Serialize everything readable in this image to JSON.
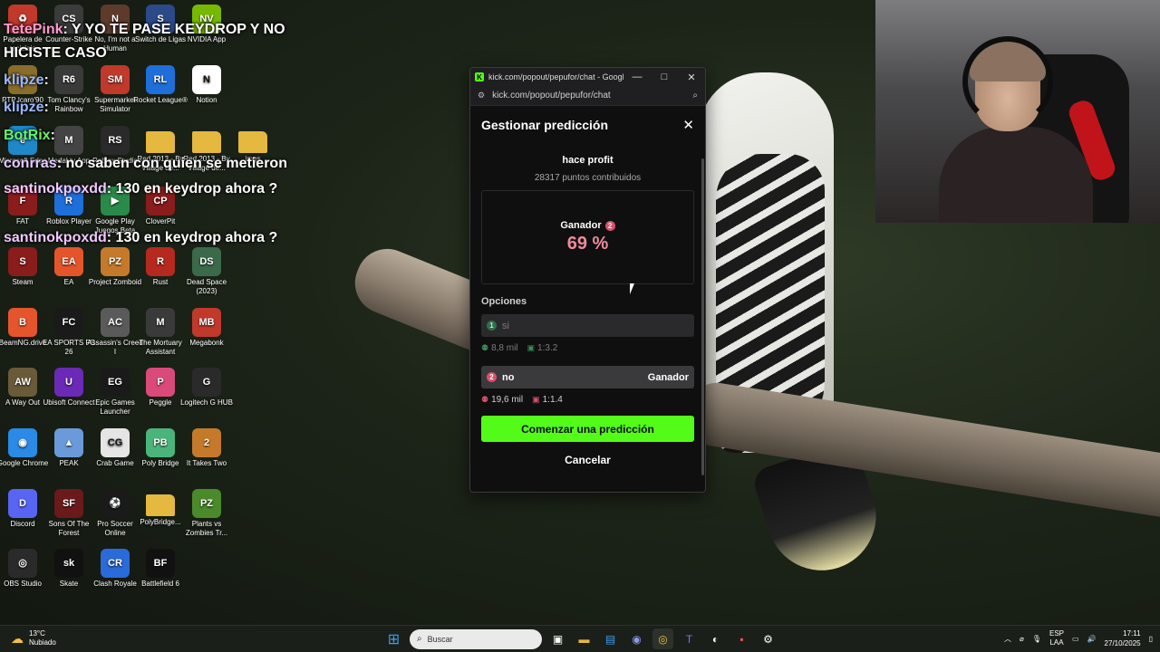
{
  "overlay_chat": [
    {
      "user": "TetePink",
      "message": ": Y YO TE PASE KEYDROP Y NO"
    },
    {
      "user": "",
      "message": "HICISTE CASO"
    },
    {
      "user": "klipze",
      "message": ":"
    },
    {
      "user": "klipze",
      "message": ":"
    },
    {
      "user": "BotRix",
      "message": ":"
    },
    {
      "user": "conrras",
      "message": ": no saben con quien se metieron"
    },
    {
      "user": "santinokpoxdd",
      "message": ": 130 en keydrop ahora ?"
    },
    {
      "user": "santinokpoxdd",
      "message": ": 130 en keydrop ahora ?"
    }
  ],
  "desktop_icons": [
    {
      "label": "Papelera de reciclaje",
      "icon": "recycle-bin-icon",
      "color": "#c0392b",
      "glyph": "♻"
    },
    {
      "label": "Counter-Strike",
      "icon": "counter-strike-icon",
      "color": "#3b3b3b",
      "glyph": "CS"
    },
    {
      "label": "No, I'm not a Human",
      "icon": "no-human-icon",
      "color": "#5e3a2a",
      "glyph": "N"
    },
    {
      "label": "Switch de Ligas",
      "icon": "switch-ligas-icon",
      "color": "#2b4a8a",
      "glyph": "S"
    },
    {
      "label": "NVIDIA App",
      "icon": "nvidia-icon",
      "color": "#76b900",
      "glyph": "NV"
    },
    {
      "label": "PTP Icaro'90",
      "icon": "ptp-icon",
      "color": "#8a6d2a",
      "glyph": "P"
    },
    {
      "label": "Tom Clancy's Rainbow",
      "icon": "rainbow-six-icon",
      "color": "#3a3a3a",
      "glyph": "R6"
    },
    {
      "label": "Supermarket Simulator",
      "icon": "supermarket-icon",
      "color": "#c0392b",
      "glyph": "SM"
    },
    {
      "label": "Rocket League®",
      "icon": "rocket-league-icon",
      "color": "#1e6fd9",
      "glyph": "RL"
    },
    {
      "label": "Notion",
      "icon": "notion-icon",
      "color": "#ffffff",
      "glyph": "N"
    },
    {
      "label": "Microsoft Edge",
      "icon": "edge-icon",
      "color": "#1e88c8",
      "glyph": "e"
    },
    {
      "label": "Medal.tv App",
      "icon": "medal-icon",
      "color": "#444",
      "glyph": "M"
    },
    {
      "label": "Roblox Studio",
      "icon": "roblox-studio-icon",
      "color": "#2a2a2a",
      "glyph": "RS"
    },
    {
      "label": "Red 2013 - Bv Village de...",
      "icon": "folder-icon",
      "color": "#e5b840",
      "glyph": ""
    },
    {
      "label": "Red 2013 - Bv Village de...",
      "icon": "folder-icon",
      "color": "#e5b840",
      "glyph": ""
    },
    {
      "label": "imgs",
      "icon": "folder-icon",
      "color": "#e5b840",
      "glyph": ""
    },
    {
      "label": "FAT",
      "icon": "fat-icon",
      "color": "#8a1c1c",
      "glyph": "F"
    },
    {
      "label": "Roblox Player",
      "icon": "roblox-icon",
      "color": "#1e6fd9",
      "glyph": "R"
    },
    {
      "label": "Google Play Juegos Beta",
      "icon": "google-play-icon",
      "color": "#2a8a4a",
      "glyph": "▶"
    },
    {
      "label": "CloverPit",
      "icon": "cloverpit-icon",
      "color": "#8a1c1c",
      "glyph": "CP"
    },
    {
      "label": "Steam",
      "icon": "steam-icon",
      "color": "#8a1c1c",
      "glyph": "S"
    },
    {
      "label": "EA",
      "icon": "ea-icon",
      "color": "#e5552b",
      "glyph": "EA"
    },
    {
      "label": "Project Zomboid",
      "icon": "project-zomboid-icon",
      "color": "#c47a2a",
      "glyph": "PZ"
    },
    {
      "label": "Rust",
      "icon": "rust-icon",
      "color": "#b5291e",
      "glyph": "R"
    },
    {
      "label": "Dead Space (2023)",
      "icon": "dead-space-icon",
      "color": "#3a6a4a",
      "glyph": "DS"
    },
    {
      "label": "BeamNG.drive",
      "icon": "beamng-icon",
      "color": "#e5552b",
      "glyph": "B"
    },
    {
      "label": "EA SPORTS FC 26",
      "icon": "fc26-icon",
      "color": "#1a1a1a",
      "glyph": "FC"
    },
    {
      "label": "Assassin's Creed I",
      "icon": "assassins-creed-icon",
      "color": "#5a5a5a",
      "glyph": "AC"
    },
    {
      "label": "The Mortuary Assistant",
      "icon": "mortuary-icon",
      "color": "#3a3a3a",
      "glyph": "M"
    },
    {
      "label": "Megabonk",
      "icon": "megabonk-icon",
      "color": "#c0392b",
      "glyph": "MB"
    },
    {
      "label": "A Way Out",
      "icon": "a-way-out-icon",
      "color": "#6a5a3a",
      "glyph": "AW"
    },
    {
      "label": "Ubisoft Connect",
      "icon": "ubisoft-icon",
      "color": "#6a2ab5",
      "glyph": "U"
    },
    {
      "label": "Epic Games Launcher",
      "icon": "epic-games-icon",
      "color": "#1a1a1a",
      "glyph": "EG"
    },
    {
      "label": "Peggle",
      "icon": "peggle-icon",
      "color": "#d94a7a",
      "glyph": "P"
    },
    {
      "label": "Logitech G HUB",
      "icon": "logitech-icon",
      "color": "#2a2a2a",
      "glyph": "G"
    },
    {
      "label": "Google Chrome",
      "icon": "chrome-icon",
      "color": "#2a8ae5",
      "glyph": "◉"
    },
    {
      "label": "PEAK",
      "icon": "peak-icon",
      "color": "#6a9ad9",
      "glyph": "▲"
    },
    {
      "label": "Crab Game",
      "icon": "crab-game-icon",
      "color": "#e5e5e5",
      "glyph": "CG"
    },
    {
      "label": "Poly Bridge",
      "icon": "poly-bridge-icon",
      "color": "#4ab57a",
      "glyph": "PB"
    },
    {
      "label": "It Takes Two",
      "icon": "it-takes-two-icon",
      "color": "#c47a2a",
      "glyph": "2"
    },
    {
      "label": "Discord",
      "icon": "discord-icon",
      "color": "#5865f2",
      "glyph": "D"
    },
    {
      "label": "Sons Of The Forest",
      "icon": "sons-forest-icon",
      "color": "#6a1a1a",
      "glyph": "SF"
    },
    {
      "label": "Pro Soccer Online",
      "icon": "pro-soccer-icon",
      "color": "#1a1a1a",
      "glyph": "⚽"
    },
    {
      "label": "PolyBridge...",
      "icon": "folder-icon",
      "color": "#e5b840",
      "glyph": ""
    },
    {
      "label": "Plants vs Zombies Tr...",
      "icon": "pvz-icon",
      "color": "#4a8a2a",
      "glyph": "PZ"
    },
    {
      "label": "OBS Studio",
      "icon": "obs-icon",
      "color": "#2a2a2a",
      "glyph": "◎"
    },
    {
      "label": "Skate",
      "icon": "skate-icon",
      "color": "#111",
      "glyph": "sk"
    },
    {
      "label": "Clash Royale",
      "icon": "clash-royale-icon",
      "color": "#2a6ad9",
      "glyph": "CR"
    },
    {
      "label": "Battlefield 6",
      "icon": "battlefield-icon",
      "color": "#111",
      "glyph": "BF"
    }
  ],
  "browser": {
    "title": "kick.com/popout/pepufor/chat - Google...",
    "url": "kick.com/popout/pepufor/chat",
    "minimize": "—",
    "maximize": "□",
    "close": "✕"
  },
  "modal": {
    "title": "Gestionar predicción",
    "close": "✕",
    "prediction_title": "hace profit",
    "points": "28317 puntos contribuidos",
    "winner_label": "Ganador",
    "winner_number": "2",
    "winner_percent": "69 %",
    "options_label": "Opciones",
    "options": [
      {
        "number": "1",
        "text": "si",
        "tag": "",
        "points": "8,8 mil",
        "ratio": "1:3.2",
        "color": "#3a8a5a"
      },
      {
        "number": "2",
        "text": "no",
        "tag": "Ganador",
        "points": "19,6 mil",
        "ratio": "1:1.4",
        "color": "#d9506a"
      }
    ],
    "cta": "Comenzar una predicción",
    "cancel": "Cancelar"
  },
  "taskbar": {
    "weather_temp": "13°C",
    "weather_desc": "Nubiado",
    "search_placeholder": "Buscar",
    "lang_top": "ESP",
    "lang_bottom": "LAA",
    "time": "17:11",
    "date": "27/10/2025"
  }
}
